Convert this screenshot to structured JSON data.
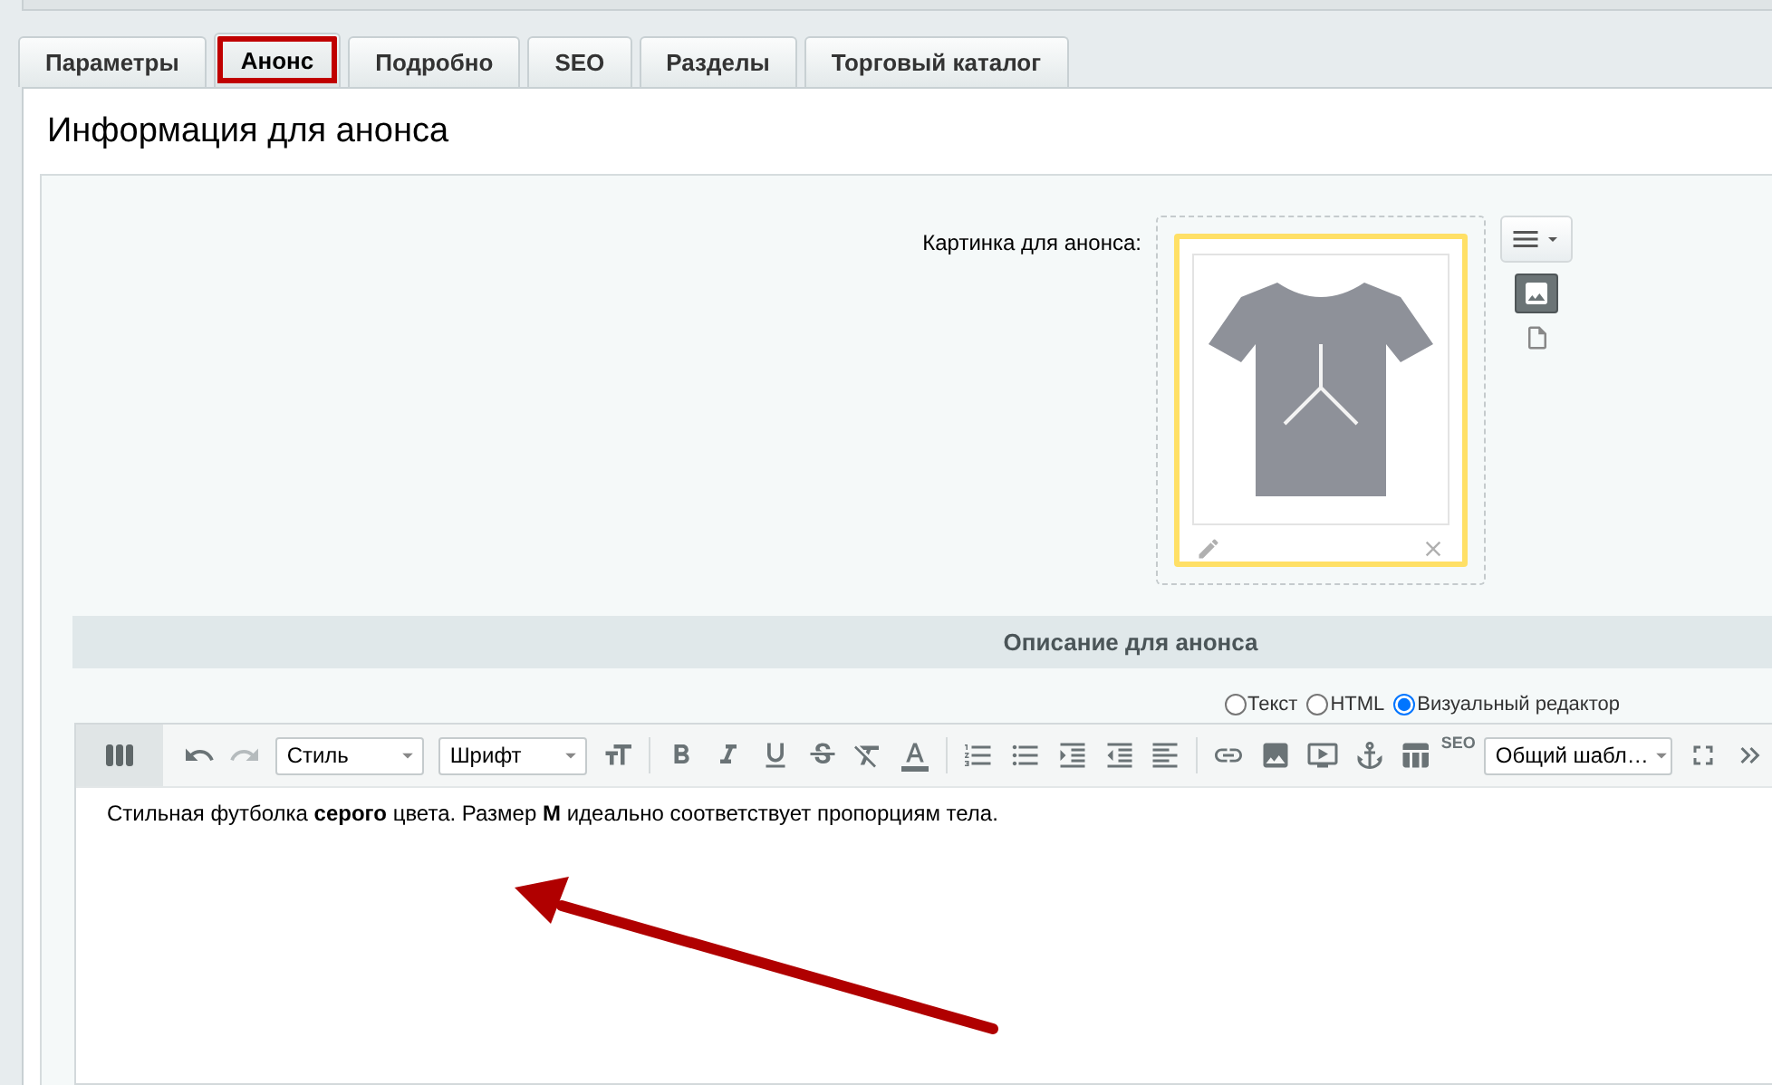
{
  "tabs": [
    {
      "label": "Параметры",
      "selected": false
    },
    {
      "label": "Анонс",
      "selected": true
    },
    {
      "label": "Подробно",
      "selected": false
    },
    {
      "label": "SEO",
      "selected": false
    },
    {
      "label": "Разделы",
      "selected": false
    },
    {
      "label": "Торговый каталог",
      "selected": false
    }
  ],
  "section_title": "Информация для анонса",
  "picture_field": {
    "label": "Картинка для анонса:"
  },
  "description": {
    "header": "Описание для анонса",
    "modes": [
      {
        "label": "Текст",
        "selected": false
      },
      {
        "label": "HTML",
        "selected": false
      },
      {
        "label": "Визуальный редактор",
        "selected": true
      }
    ],
    "toolbar": {
      "style_select": "Стиль",
      "font_select": "Шрифт",
      "seo_label": "SEO",
      "template_select": "Общий шабл…"
    },
    "body": "Стильная футболка **серого** цвета. Размер **M** идеально соответствует пропорциям тела."
  }
}
